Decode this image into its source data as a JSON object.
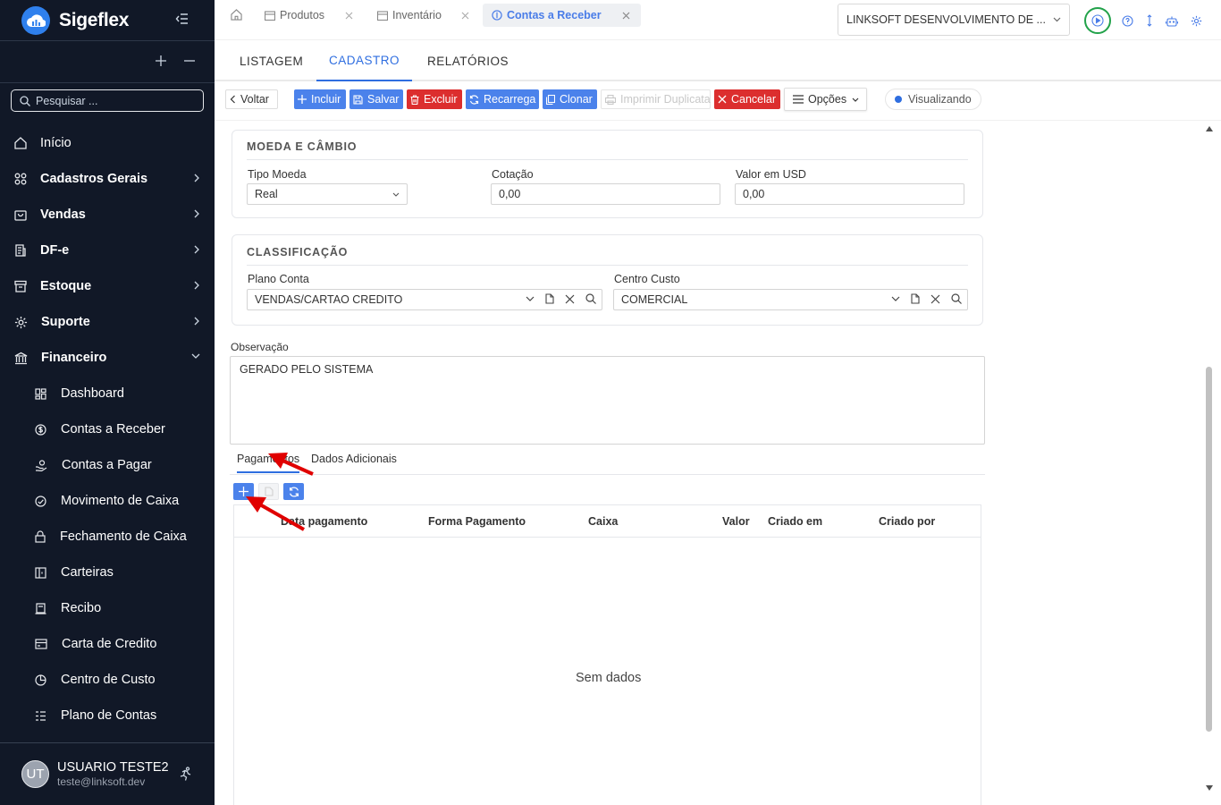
{
  "app": {
    "name": "Sigeflex"
  },
  "sidebar": {
    "search_placeholder": "Pesquisar ...",
    "items": [
      {
        "label": "Início",
        "icon": "home-icon"
      },
      {
        "label": "Cadastros Gerais",
        "icon": "grid-icon"
      },
      {
        "label": "Vendas",
        "icon": "bag-icon"
      },
      {
        "label": "DF-e",
        "icon": "document-icon"
      },
      {
        "label": "Estoque",
        "icon": "archive-icon"
      },
      {
        "label": "Suporte",
        "icon": "gear-icon"
      },
      {
        "label": "Financeiro",
        "icon": "bank-icon"
      }
    ],
    "sub_items": [
      {
        "label": "Dashboard",
        "icon": "dashboard-icon"
      },
      {
        "label": "Contas a Receber",
        "icon": "dollar-circle-icon"
      },
      {
        "label": "Contas a Pagar",
        "icon": "hand-coin-icon"
      },
      {
        "label": "Movimento de Caixa",
        "icon": "check-circle-icon"
      },
      {
        "label": "Fechamento de Caixa",
        "icon": "lock-icon"
      },
      {
        "label": "Carteiras",
        "icon": "wallet-icon"
      },
      {
        "label": "Recibo",
        "icon": "receipt-icon"
      },
      {
        "label": "Carta de Credito",
        "icon": "credit-card-icon"
      },
      {
        "label": "Centro de Custo",
        "icon": "pie-icon"
      },
      {
        "label": "Plano de Contas",
        "icon": "list-check-icon"
      }
    ],
    "user": {
      "initials": "UT",
      "name": "USUARIO TESTE2",
      "email": "teste@linksoft.dev"
    }
  },
  "topbar": {
    "tabs": [
      {
        "label": "Produtos",
        "icon": "calendar-icon"
      },
      {
        "label": "Inventário",
        "icon": "calendar-icon"
      },
      {
        "label": "Contas a Receber",
        "icon": "dollar-circle-icon",
        "active": true
      }
    ],
    "company": "LINKSOFT DESENVOLVIMENTO DE ..."
  },
  "section_tabs": [
    "LISTAGEM",
    "CADASTRO",
    "RELATÓRIOS"
  ],
  "toolbar": {
    "back": "Voltar",
    "incluir": "Incluir",
    "salvar": "Salvar",
    "excluir": "Excluir",
    "recarrega": "Recarrega",
    "clonar": "Clonar",
    "imprimir": "Imprimir Duplicata",
    "cancelar": "Cancelar",
    "opcoes": "Opções",
    "status": "Visualizando"
  },
  "moeda": {
    "title": "MOEDA E CÂMBIO",
    "tipo_label": "Tipo Moeda",
    "tipo_value": "Real",
    "cotacao_label": "Cotação",
    "cotacao_value": "0,00",
    "usd_label": "Valor em USD",
    "usd_value": "0,00"
  },
  "classificacao": {
    "title": "CLASSIFICAÇÃO",
    "plano_label": "Plano Conta",
    "plano_value": "VENDAS/CARTAO CREDITO",
    "centro_label": "Centro Custo",
    "centro_value": "COMERCIAL"
  },
  "observacao": {
    "label": "Observação",
    "value": "GERADO PELO SISTEMA"
  },
  "payments": {
    "tabs": [
      "Pagamentos",
      "Dados Adicionais"
    ],
    "columns": [
      "Data pagamento",
      "Forma Pagamento",
      "Caixa",
      "Valor",
      "Criado em",
      "Criado por"
    ],
    "empty": "Sem dados"
  },
  "colors": {
    "sidebar_bg": "#111827",
    "primary": "#4b82eb",
    "danger": "#dc2e2e",
    "accent_tab": "#2f6ee0",
    "annotation": "#e00000"
  }
}
